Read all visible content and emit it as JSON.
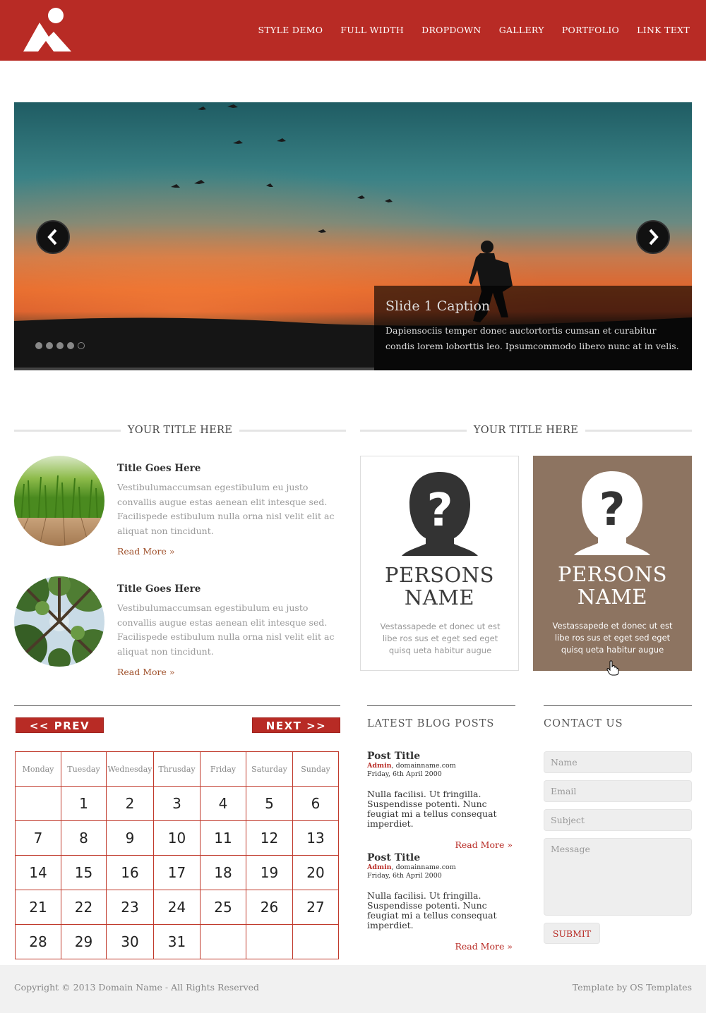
{
  "header": {
    "nav": [
      "STYLE DEMO",
      "FULL WIDTH",
      "DROPDOWN",
      "GALLERY",
      "PORTFOLIO",
      "LINK TEXT"
    ],
    "brand_color": "#b82b25"
  },
  "slider": {
    "caption_title": "Slide 1 Caption",
    "caption_text": "Dapiensociis temper donec auctortortis cumsan et curabitur condis lorem loborttis leo. Ipsumcommodo libero nunc at in velis.",
    "dots": 5,
    "active_dot": 5
  },
  "left_section": {
    "title": "YOUR TITLE HERE",
    "articles": [
      {
        "title": "Title Goes Here",
        "text": "Vestibulumaccumsan egestibulum eu justo convallis augue estas aenean elit intesque sed. Facilispede estibulum nulla orna nisl velit elit ac aliquat non tincidunt.",
        "more": "Read More »",
        "image": "grass-photo"
      },
      {
        "title": "Title Goes Here",
        "text": "Vestibulumaccumsan egestibulum eu justo convallis augue estas aenean elit intesque sed. Facilispede estibulum nulla orna nisl velit elit ac aliquat non tincidunt.",
        "more": "Read More »",
        "image": "trees-photo"
      }
    ]
  },
  "right_section": {
    "title": "YOUR TITLE HERE",
    "cards": [
      {
        "name_line1": "PERSONS",
        "name_line2": "NAME",
        "text": "Vestassapede et donec ut est libe ros sus et eget sed eget quisq ueta habitur augue"
      },
      {
        "name_line1": "PERSONS",
        "name_line2": "NAME",
        "text": "Vestassapede et donec ut est libe ros sus et eget sed eget quisq ueta habitur augue"
      }
    ]
  },
  "calendar": {
    "prev": "<< PREV",
    "next": "NEXT >>",
    "days": [
      "Monday",
      "Tuesday",
      "Wednesday",
      "Thrusday",
      "Friday",
      "Saturday",
      "Sunday"
    ],
    "weeks": [
      [
        "",
        "1",
        "2",
        "3",
        "4",
        "5",
        "6"
      ],
      [
        "7",
        "8",
        "9",
        "10",
        "11",
        "12",
        "13"
      ],
      [
        "14",
        "15",
        "16",
        "17",
        "18",
        "19",
        "20"
      ],
      [
        "21",
        "22",
        "23",
        "24",
        "25",
        "26",
        "27"
      ],
      [
        "28",
        "29",
        "30",
        "31",
        "",
        "",
        ""
      ]
    ]
  },
  "blog": {
    "title": "LATEST BLOG POSTS",
    "posts": [
      {
        "title": "Post Title",
        "author": "Admin",
        "domain": ", domainname.com",
        "date": "Friday, 6th April 2000",
        "text": "Nulla facilisi. Ut fringilla. Suspendisse potenti. Nunc feugiat mi a tellus consequat imperdiet.",
        "more": "Read More »"
      },
      {
        "title": "Post Title",
        "author": "Admin",
        "domain": ", domainname.com",
        "date": "Friday, 6th April 2000",
        "text": "Nulla facilisi. Ut fringilla. Suspendisse potenti. Nunc feugiat mi a tellus consequat imperdiet.",
        "more": "Read More »"
      }
    ]
  },
  "contact": {
    "title": "CONTACT US",
    "name_placeholder": "Name",
    "email_placeholder": "Email",
    "subject_placeholder": "Subject",
    "message_placeholder": "Message",
    "submit": "SUBMIT"
  },
  "footer": {
    "copyright": "Copyright © 2013 Domain Name - All Rights Reserved",
    "credit": "Template by OS Templates"
  }
}
